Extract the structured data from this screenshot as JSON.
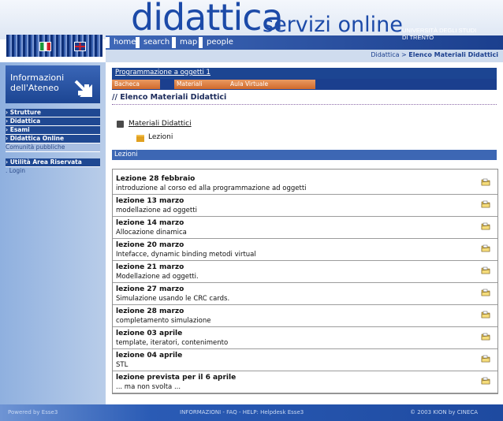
{
  "header": {
    "brand_main": "didattica",
    "brand_sub": "servizi online",
    "nav": [
      "home",
      "search",
      "map",
      "people"
    ],
    "university": "UNIVERSITÀ DEGLI STUDI DI TRENTO",
    "breadcrumb_root": "Didattica",
    "breadcrumb_sep": " > ",
    "breadcrumb_current": "Elenco Materiali Didattici"
  },
  "sidebar": {
    "info_title": "Informazioni dell'Ateneo",
    "items": [
      {
        "label": "› Strutture"
      },
      {
        "label": "› Didattica"
      },
      {
        "label": "› Esami"
      },
      {
        "label": "› Didattica Online"
      },
      {
        "label": "Comunità pubbliche"
      },
      {
        "label": "› Utilità Area Riservata"
      },
      {
        "label": ". Login"
      }
    ]
  },
  "main": {
    "course_link": "Programmazione a oggetti 1",
    "tabs": [
      "Bacheca",
      "Materiali Didattici",
      "Aula Virtuale"
    ],
    "section_title": "// Elenco Materiali Didattici",
    "materials_link": "Materiali Didattici",
    "folder_label": "Lezioni",
    "list_header": "Lezioni",
    "lessons": [
      {
        "title": "Lezione 28 febbraio",
        "desc": "introduzione al corso ed alla programmazione ad oggetti"
      },
      {
        "title": "lezione 13 marzo",
        "desc": "modellazione ad oggetti"
      },
      {
        "title": "lezione 14 marzo",
        "desc": "Allocazione dinamica"
      },
      {
        "title": "lezione 20 marzo",
        "desc": "Intefacce, dynamic binding metodi virtual"
      },
      {
        "title": "lezione 21 marzo",
        "desc": "Modellazione ad oggetti."
      },
      {
        "title": "lezione 27 marzo",
        "desc": "Simulazione usando le CRC cards."
      },
      {
        "title": "lezione 28 marzo",
        "desc": "completamento simulazione"
      },
      {
        "title": "lezione 03 aprile",
        "desc": "template, iteratori, contenimento"
      },
      {
        "title": "lezione 04 aprile",
        "desc": "STL"
      },
      {
        "title": "lezione prevista per il 6 aprile",
        "desc": "... ma non svolta ..."
      }
    ]
  },
  "footer": {
    "powered": "Powered by Esse3",
    "info": "INFORMAZIONI - FAQ - HELP: Helpdesk Esse3",
    "copyright": "© 2003 KION by CINECA"
  }
}
